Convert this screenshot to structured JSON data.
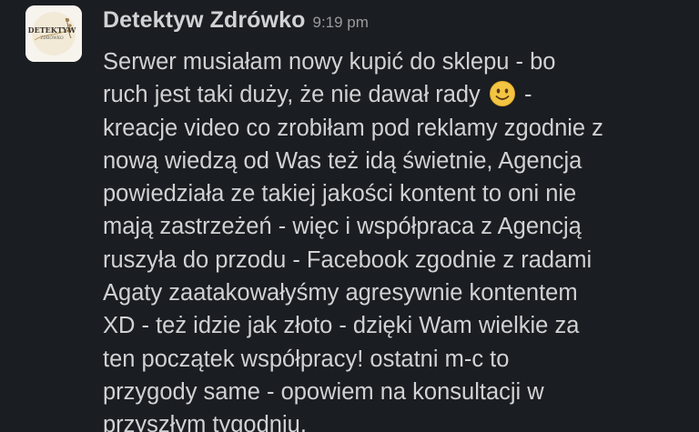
{
  "message": {
    "author": "Detektyw Zdrówko",
    "time": "9:19 pm",
    "avatar": {
      "brand_text": "DETEKTYW",
      "brand_subtext": "ZDRÓWKO",
      "background": "#f7f4ee",
      "ring_color": "#c9ad7a"
    },
    "lines": [
      {
        "text": "Serwer musiałam nowy kupić do sklepu - bo"
      },
      {
        "before": "ruch jest taki duży, że nie dawał rady",
        "emoji": "slightly-smiling-face-emoji",
        "after": "-"
      },
      {
        "text": "kreacje video co zrobiłam pod reklamy zgodnie z"
      },
      {
        "text": "nową wiedzą od Was też idą świetnie, Agencja"
      },
      {
        "text": "powiedziała ze takiej jakości kontent to oni nie"
      },
      {
        "text": "mają zastrzeżeń - więc i współpraca z Agencją"
      },
      {
        "text": "ruszyła do przodu - Facebook zgodnie z radami"
      },
      {
        "text": "Agaty zaatakowałyśmy agresywnie kontentem"
      },
      {
        "text": "XD - też idzie jak złoto - dzięki Wam wielkie za"
      },
      {
        "text": "ten początek współpracy! ostatni m-c to"
      },
      {
        "text": "przygody same - opowiem na konsultacji w"
      },
      {
        "text": "przyszłym tygodniu."
      }
    ]
  },
  "colors": {
    "background": "#1a1d21",
    "text": "#d1d2d3",
    "timestamp": "#9a9b9d",
    "emoji_face": "#f4c542"
  }
}
